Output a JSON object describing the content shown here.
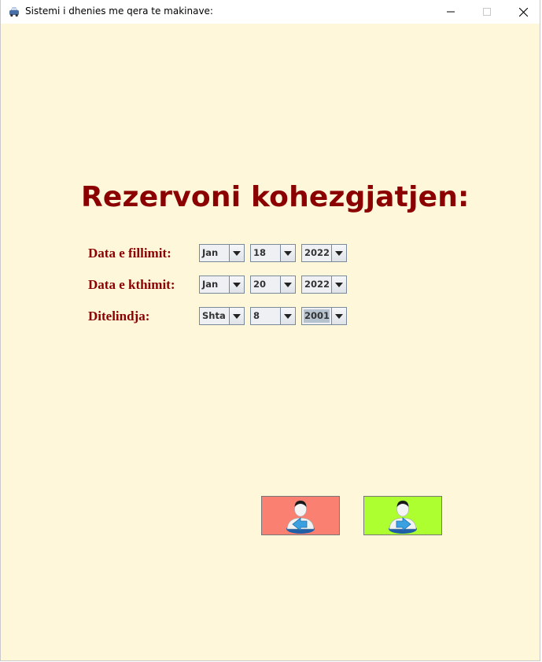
{
  "window": {
    "title": "Sistemi i dhenies me qera te makinave:",
    "app_icon": "car-icon"
  },
  "main": {
    "heading": "Rezervoni kohezgjatjen:",
    "rows": [
      {
        "label": "Data e fillimit:",
        "month": "Jan",
        "day": "18",
        "year": "2022"
      },
      {
        "label": "Data e kthimit:",
        "month": "Jan",
        "day": "20",
        "year": "2022"
      },
      {
        "label": "Ditelindja:",
        "month": "Shta",
        "day": "8",
        "year": "2001"
      }
    ],
    "buttons": [
      {
        "name": "back-user-button",
        "icon": "user-arrow-left-icon",
        "color": "#fa8072"
      },
      {
        "name": "next-user-button",
        "icon": "user-arrow-right-icon",
        "color": "#adff2f"
      }
    ]
  },
  "colors": {
    "background": "#fff7d9",
    "heading": "#8b0000",
    "label": "#8b0000"
  }
}
